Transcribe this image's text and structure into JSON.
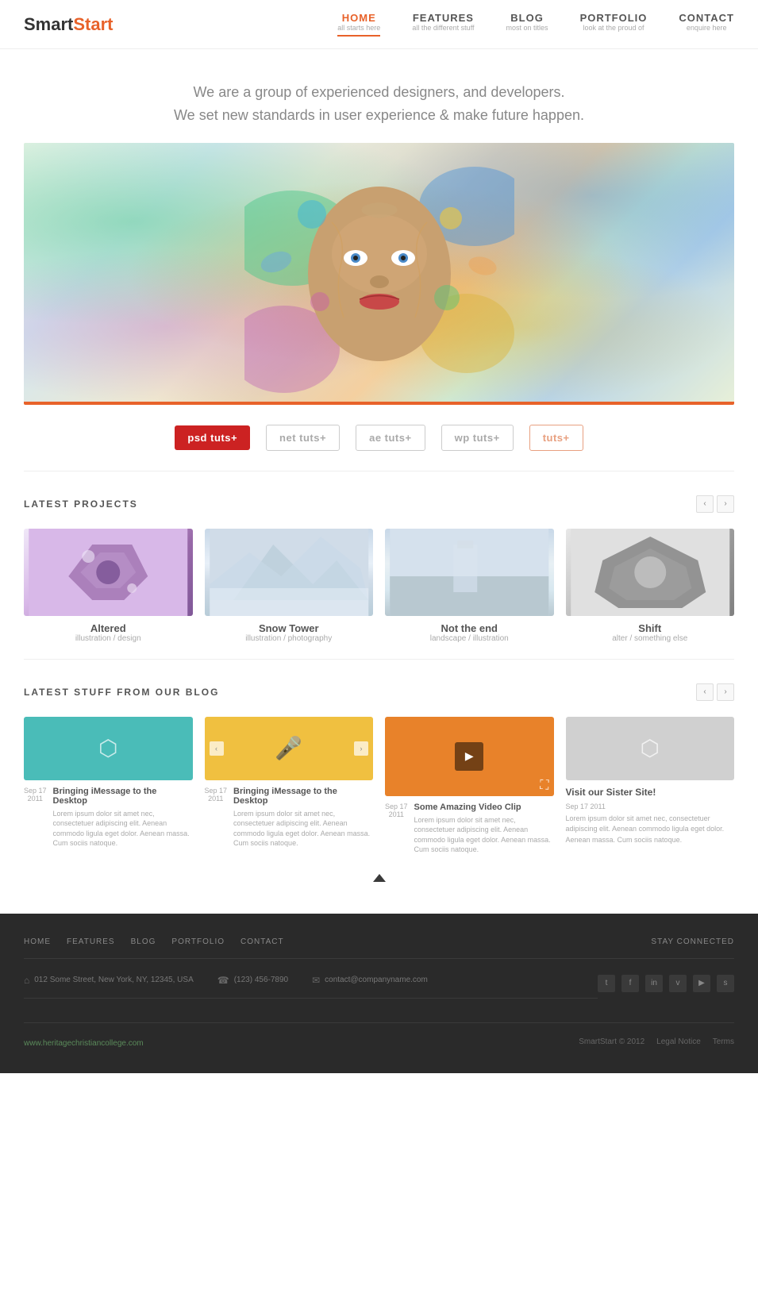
{
  "header": {
    "logo_smart": "Smart",
    "logo_start": "Start",
    "nav": [
      {
        "id": "home",
        "label": "HOME",
        "sub": "all starts here",
        "active": true
      },
      {
        "id": "features",
        "label": "FEATURES",
        "sub": "all the different stuff",
        "active": false
      },
      {
        "id": "blog",
        "label": "BLOG",
        "sub": "most on titles",
        "active": false
      },
      {
        "id": "portfolio",
        "label": "PORTFOLIO",
        "sub": "look at the proud of",
        "active": false
      },
      {
        "id": "contact",
        "label": "CONTACT",
        "sub": "enquire here",
        "active": false
      }
    ]
  },
  "hero": {
    "tagline_line1": "We are a group of experienced designers, and developers.",
    "tagline_line2": "We set new standards in user experience & make future happen."
  },
  "brands": [
    {
      "id": "psd",
      "label": "psd tuts+",
      "style": "psd"
    },
    {
      "id": "net",
      "label": "net tuts+",
      "style": "net"
    },
    {
      "id": "ae",
      "label": "ae tuts+",
      "style": "ae"
    },
    {
      "id": "wp",
      "label": "wp tuts+",
      "style": "wp"
    },
    {
      "id": "tuts",
      "label": "tuts+",
      "style": "tuts"
    }
  ],
  "projects": {
    "section_title": "LATEST PROJECTS",
    "items": [
      {
        "id": "altered",
        "title": "Altered",
        "sub": "illustration / design",
        "thumb_class": "thumb-altered"
      },
      {
        "id": "snow-tower",
        "title": "Snow Tower",
        "sub": "illustration / photography",
        "thumb_class": "thumb-snow"
      },
      {
        "id": "not-the-end",
        "title": "Not the end",
        "sub": "landscape / illustration",
        "thumb_class": "thumb-notend"
      },
      {
        "id": "shift",
        "title": "Shift",
        "sub": "alter / something else",
        "thumb_class": "thumb-shift"
      }
    ]
  },
  "blog": {
    "section_title": "LATEST STUFF FROM OUR BLOG",
    "items": [
      {
        "id": "blog1",
        "thumb_type": "teal",
        "title": "Bringing iMessage to the Desktop",
        "date_sep": "Sep 17",
        "date_year": "2011",
        "text": "Lorem ipsum dolor sit amet nec, consectetuer adipiscing elit. Aenean commodo ligula eget dolor. Aenean massa. Cum sociis natoque."
      },
      {
        "id": "blog2",
        "thumb_type": "yellow",
        "title": "Bringing iMessage to the Desktop",
        "date_sep": "Sep 17",
        "date_year": "2011",
        "text": "Lorem ipsum dolor sit amet nec, consectetuer adipiscing elit. Aenean commodo ligula eget dolor. Aenean massa. Cum sociis natoque."
      },
      {
        "id": "blog3",
        "thumb_type": "orange",
        "title": "Some Amazing Video Clip",
        "date_sep": "Sep 17",
        "date_year": "2011",
        "text": "Lorem ipsum dolor sit amet nec, consectetuer adipiscing elit. Aenean commodo ligula eget dolor. Aenean massa. Cum sociis natoque."
      },
      {
        "id": "blog4",
        "thumb_type": "text",
        "sister_title": "Visit our Sister Site!",
        "sister_date": "Sep 17 2011",
        "sister_text": "Lorem ipsum dolor sit amet nec, consectetuer adipiscing elit. Aenean commodo ligula eget dolor. Aenean massa. Cum sociis natoque."
      }
    ]
  },
  "footer": {
    "nav_items": [
      "HOME",
      "FEATURES",
      "BLOG",
      "PORTFOLIO",
      "CONTACT"
    ],
    "stay_connected": "STAY CONNECTED",
    "address": "012 Some Street, New York, NY, 12345, USA",
    "phone": "(123) 456-7890",
    "email": "contact@companyname.com",
    "url": "www.heritagechristiancollege.com",
    "copyright": "SmartStart © 2012",
    "legal": "Legal Notice",
    "terms": "Terms",
    "social_icons": [
      "t",
      "f",
      "in",
      "v",
      "yt",
      "s"
    ]
  }
}
